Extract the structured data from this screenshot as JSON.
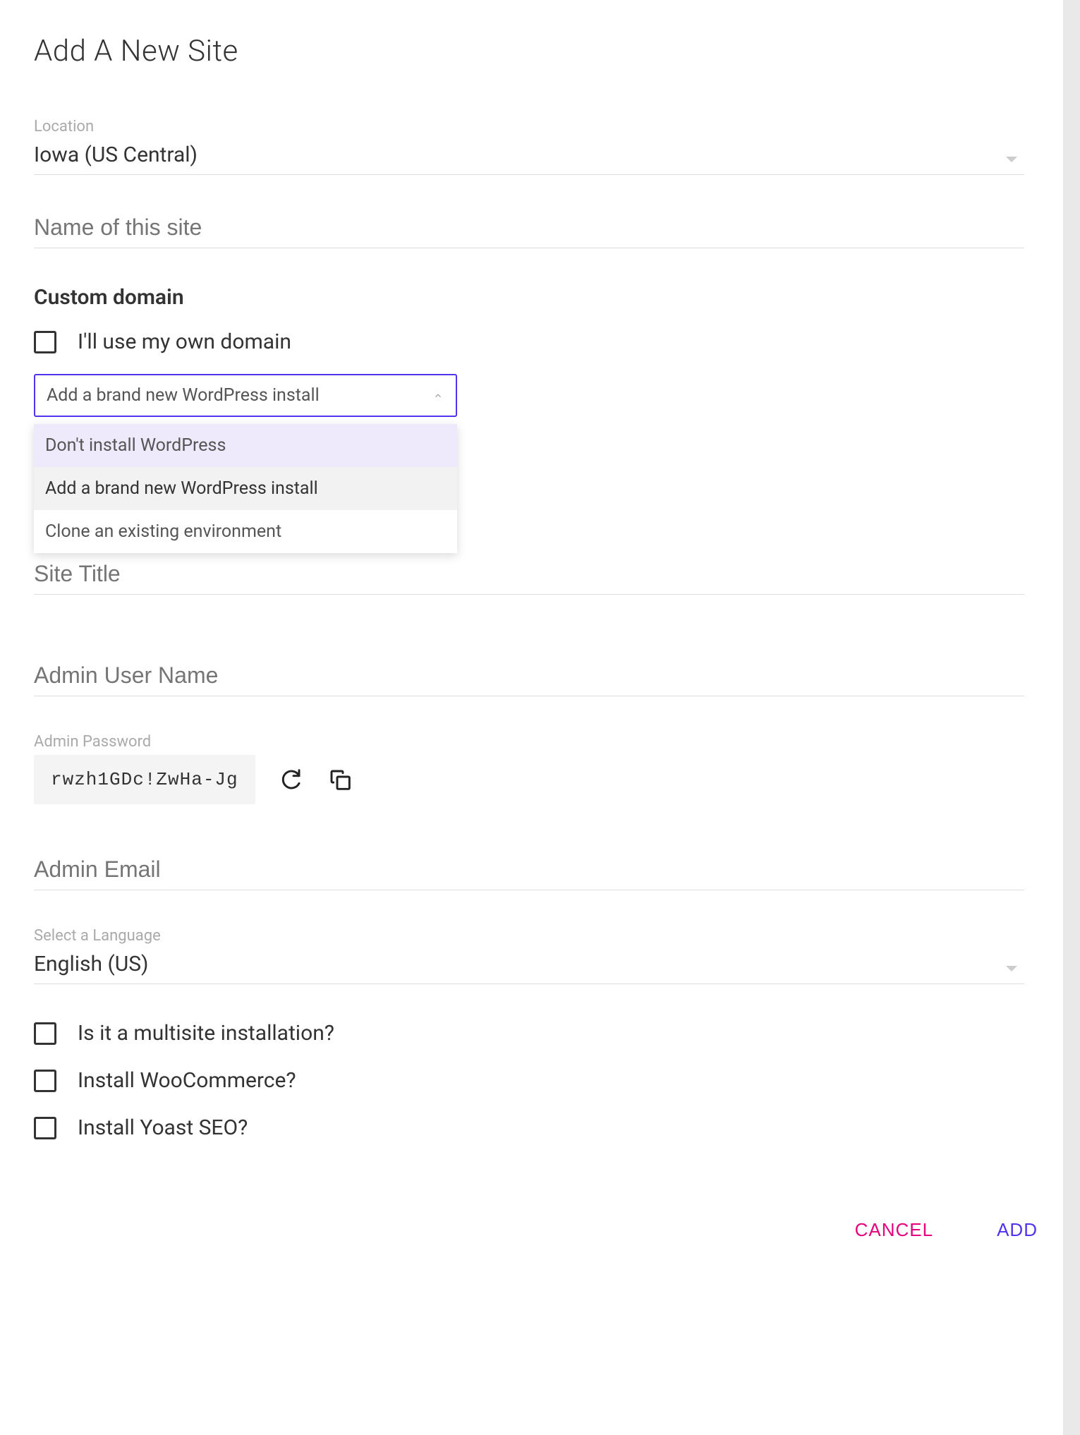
{
  "title": "Add A New Site",
  "location": {
    "label": "Location",
    "value": "Iowa (US Central)"
  },
  "site_name": {
    "placeholder": "Name of this site"
  },
  "custom_domain": {
    "heading": "Custom domain",
    "own_domain_label": "I'll use my own domain"
  },
  "install_select": {
    "selected": "Add a brand new WordPress install",
    "options": [
      "Don't install WordPress",
      "Add a brand new WordPress install",
      "Clone an existing environment"
    ]
  },
  "site_title": {
    "placeholder": "Site Title"
  },
  "admin_user": {
    "placeholder": "Admin User Name"
  },
  "admin_password": {
    "label": "Admin Password",
    "value": "rwzh1GDc!ZwHa-Jg"
  },
  "admin_email": {
    "placeholder": "Admin Email"
  },
  "language": {
    "label": "Select a Language",
    "value": "English (US)"
  },
  "options": {
    "multisite": "Is it a multisite installation?",
    "woocommerce": "Install WooCommerce?",
    "yoast": "Install Yoast SEO?"
  },
  "actions": {
    "cancel": "CANCEL",
    "add": "ADD"
  }
}
